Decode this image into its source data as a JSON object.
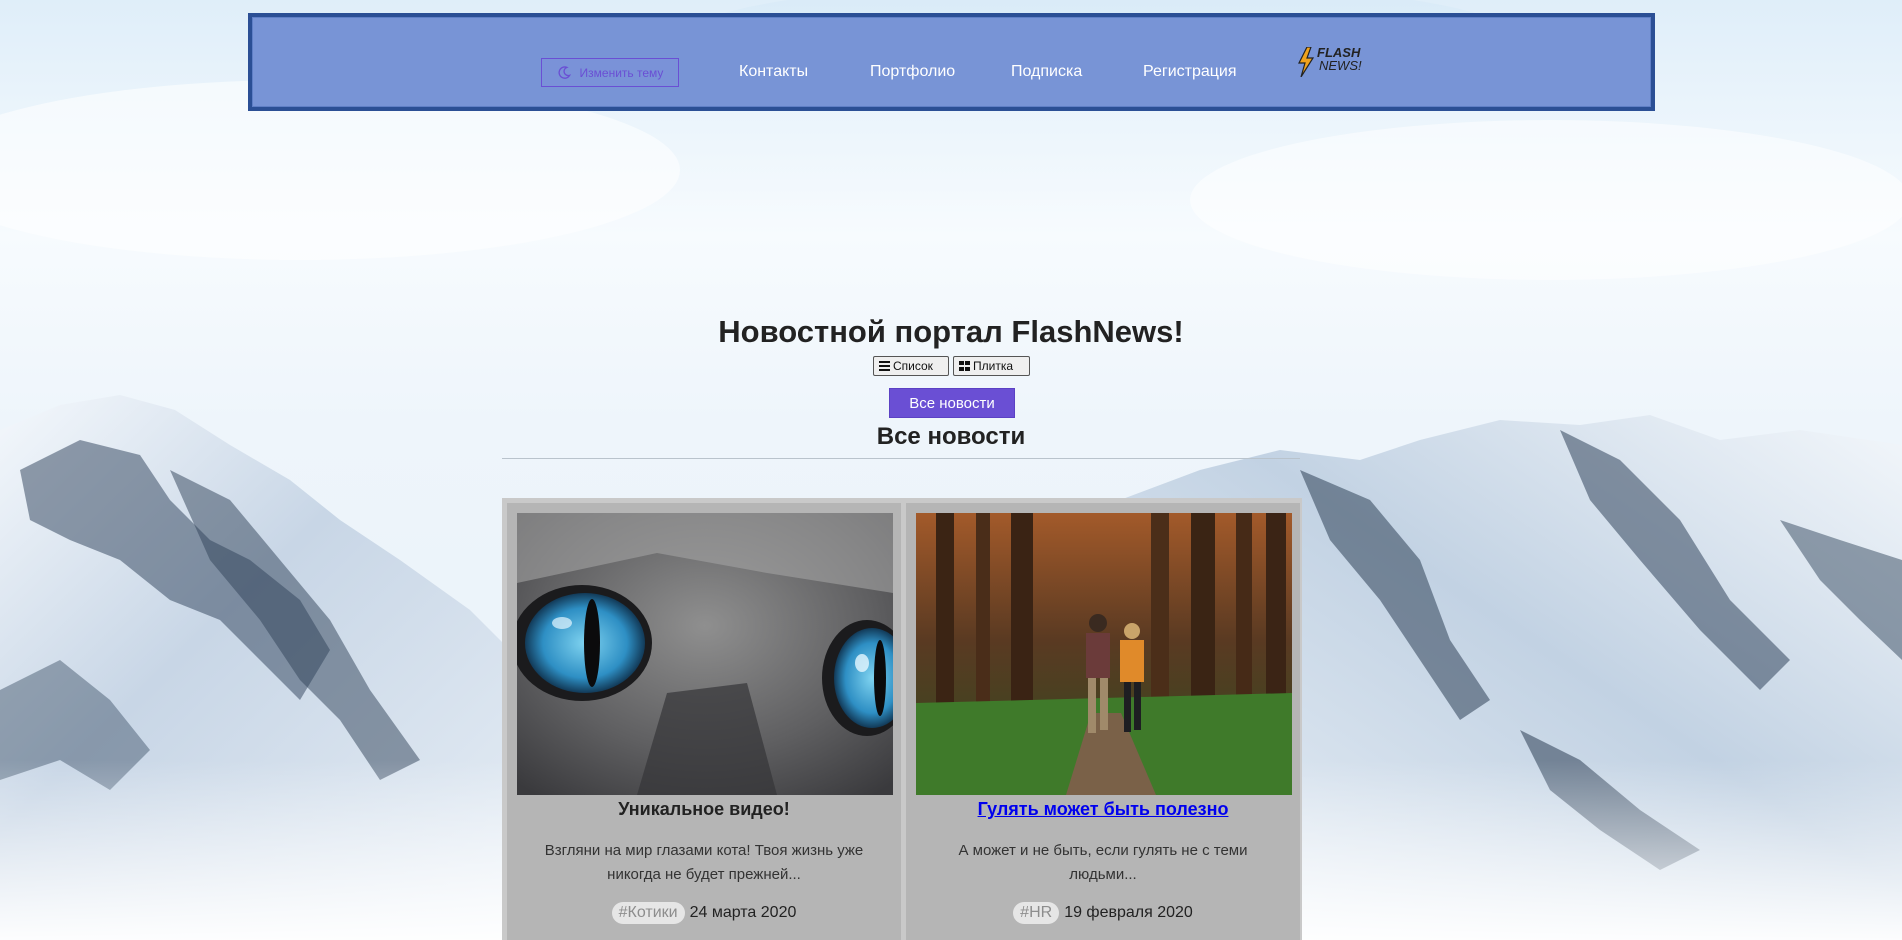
{
  "header": {
    "theme_button": {
      "label": "Изменить тему",
      "icon": "moon-icon"
    },
    "nav": [
      {
        "label": "Контакты"
      },
      {
        "label": "Портфолио"
      },
      {
        "label": "Подписка"
      },
      {
        "label": "Регистрация"
      }
    ],
    "logo": {
      "line1": "FLASH",
      "line2": "NEWS!",
      "icon": "lightning-icon"
    }
  },
  "main": {
    "title": "Новостной портал FlashNews!",
    "view_toggle": {
      "list_label": "Список",
      "tiles_label": "Плитка"
    },
    "filter_button": "Все новости",
    "section_title": "Все новости",
    "cards": [
      {
        "title": "Уникальное видео!",
        "description": "Взгляни на мир глазами кота! Твоя жизнь уже никогда не будет прежней...",
        "tag": "#Котики",
        "date": "24 марта 2020",
        "image": "cat-eyes-photo"
      },
      {
        "title": "Гулять может быть полезно",
        "description": "А может и не быть, если гулять не с теми людьми...",
        "tag": "#HR",
        "date": "19 февраля 2020",
        "image": "forest-walk-photo"
      }
    ]
  },
  "colors": {
    "header_bg": "#7894d6",
    "header_border": "#2b4f95",
    "accent": "#6a4fd4",
    "link": "#0000ee",
    "card_bg": "#b5b5b5"
  }
}
